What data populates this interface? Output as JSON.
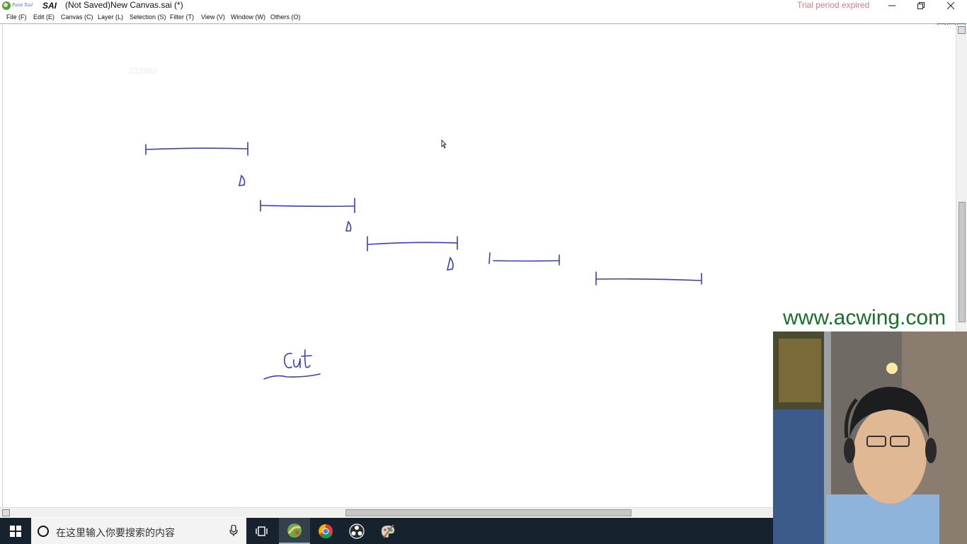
{
  "titlebar": {
    "app_name": "SAI",
    "app_subtitle": "Paint Tool",
    "window_title": "(Not Saved)New Canvas.sai (*)",
    "trial_text": "Trial period expired",
    "trial_color": "#e07a86"
  },
  "menu": {
    "items": [
      {
        "label": "File (F)",
        "icon": "none"
      },
      {
        "label": "Edit (E)",
        "icon": "none"
      },
      {
        "label": "Canvas (C)",
        "icon": "none"
      },
      {
        "label": "Layer (L)",
        "icon": "none"
      },
      {
        "label": "Selection (S)",
        "icon": "none"
      },
      {
        "label": "Filter (T)",
        "icon": "none"
      },
      {
        "label": "View (V)",
        "icon": "none"
      },
      {
        "label": "Window (W)",
        "icon": "none"
      },
      {
        "label": "Others (O)",
        "icon": "none"
      }
    ]
  },
  "canvas": {
    "faint_number": "232962",
    "ink_color": "#3b3fbf",
    "handwritten_word": "Cut"
  },
  "watermark": {
    "text": "www.acwing.com",
    "color": "#1a6f2a"
  },
  "taskbar": {
    "search_placeholder": "在这里输入你要搜索的内容",
    "icons": [
      "windows-start-icon",
      "cortana-icon",
      "microphone-icon",
      "task-view-icon",
      "paint-tool-sai-icon",
      "chrome-icon",
      "obs-icon",
      "paint-palette-icon"
    ]
  }
}
